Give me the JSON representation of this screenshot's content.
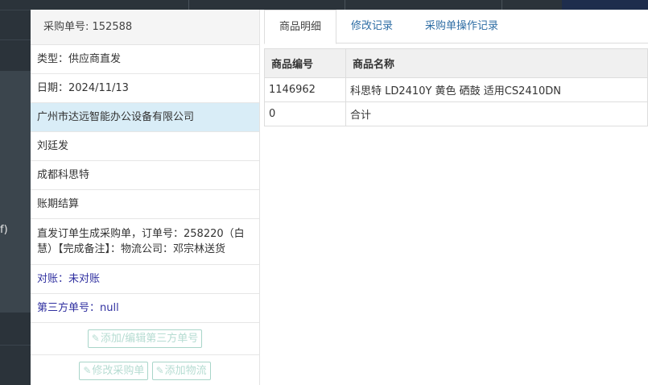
{
  "background": {
    "paren_text": "f)"
  },
  "order": {
    "number_text": "采购单号: 152588",
    "type_text": "类型：供应商直发",
    "date_text": "日期：2024/11/13",
    "supplier": "广州市达远智能办公设备有限公司",
    "person": "刘廷发",
    "company": "成都科思特",
    "settlement": "账期结算",
    "note": "直发订单生成采购单，订单号：258220（白慧）【完成备注】：物流公司：邓宗林送货",
    "reconcile_text": "对账：未对账",
    "third_party_text": "第三方单号：null"
  },
  "buttons": {
    "edit_third_party": "添加/编辑第三方单号",
    "edit_order": "修改采购单",
    "add_logistics": "添加物流"
  },
  "tabs": [
    {
      "label": "商品明细"
    },
    {
      "label": "修改记录"
    },
    {
      "label": "采购单操作记录"
    }
  ],
  "table": {
    "headers": [
      "商品编号",
      "商品名称"
    ],
    "rows": [
      [
        "1146962",
        "科思特 LD2410Y 黄色 硒鼓 适用CS2410DN"
      ],
      [
        "0",
        "合计"
      ]
    ]
  },
  "colors": {
    "highlight": "#d9edf7",
    "link": "#2e6da4",
    "dark_bg": "#2b333a"
  }
}
